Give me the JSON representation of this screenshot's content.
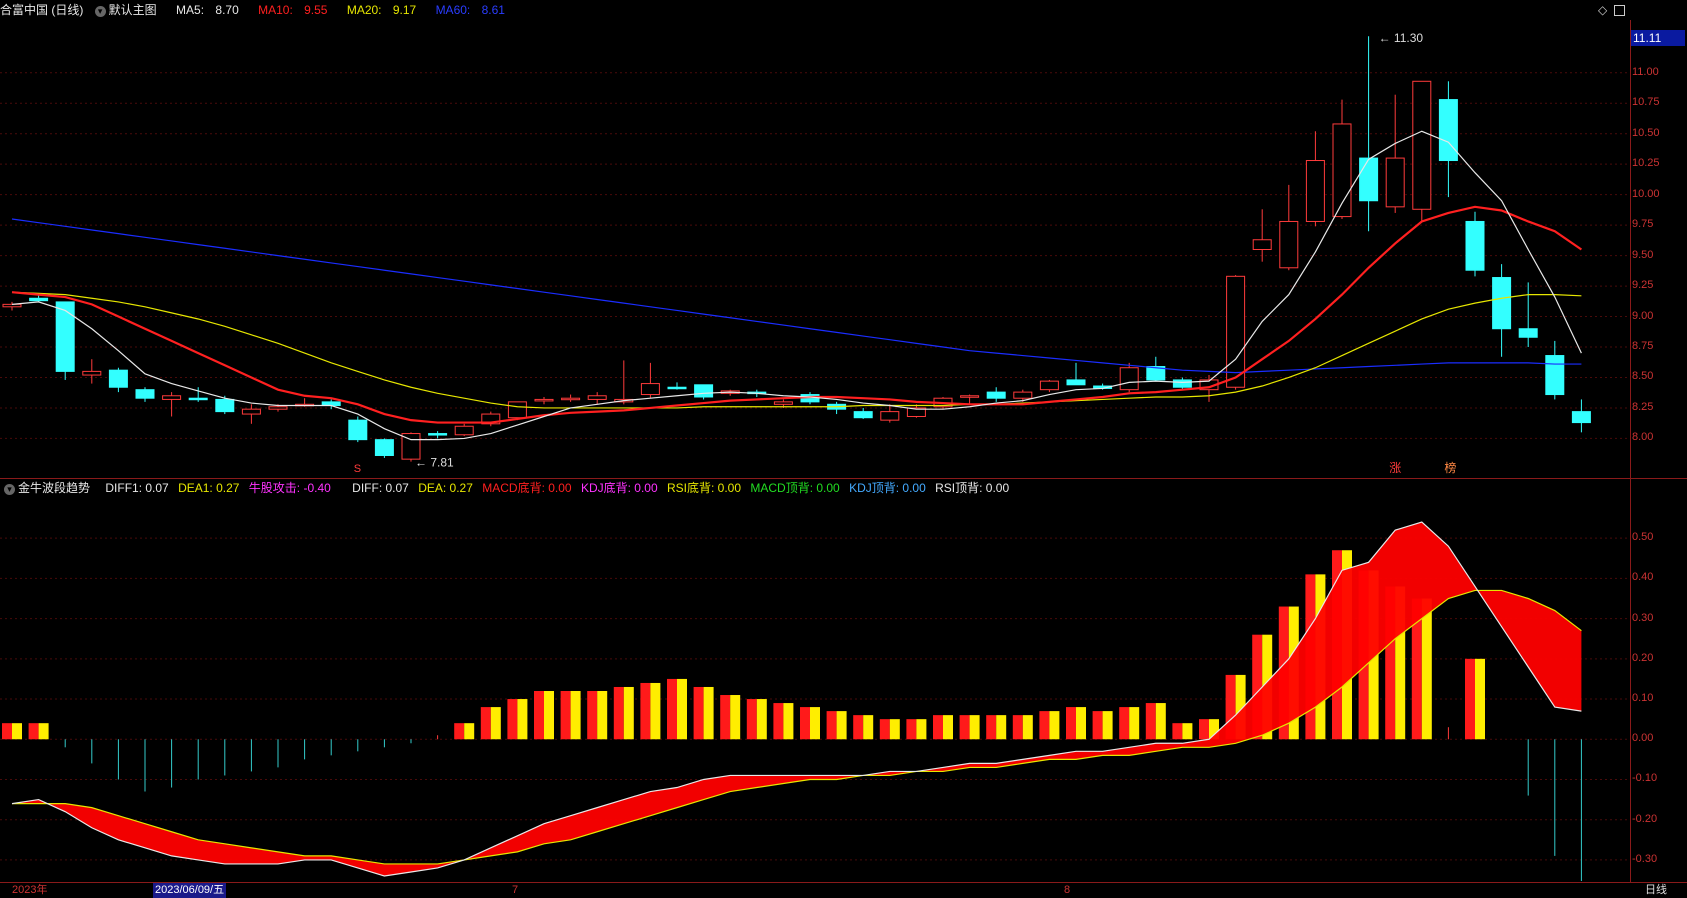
{
  "header": {
    "title": "合富中国 (日线)",
    "template": "默认主图",
    "ma5_label": "MA5:",
    "ma5_value": "8.70",
    "ma10_label": "MA10:",
    "ma10_value": "9.55",
    "ma20_label": "MA20:",
    "ma20_value": "9.17",
    "ma60_label": "MA60:",
    "ma60_value": "8.61"
  },
  "indicator": {
    "name": "金牛波段趋势",
    "diff1": "DIFF1: 0.07",
    "dea1": "DEA1: 0.27",
    "bull": "牛股攻击: -0.40",
    "diff": "DIFF: 0.07",
    "dea": "DEA: 0.27",
    "macd_bottom": "MACD底背: 0.00",
    "kdj_bottom": "KDJ底背: 0.00",
    "rsi_bottom": "RSI底背: 0.00",
    "macd_top": "MACD顶背: 0.00",
    "kdj_top": "KDJ顶背: 0.00",
    "rsi_top": "RSI顶背: 0.00"
  },
  "price_axis": [
    "11.00",
    "10.75",
    "10.50",
    "10.25",
    "10.00",
    "9.75",
    "9.50",
    "9.25",
    "9.00",
    "8.75",
    "8.50",
    "8.25",
    "8.00"
  ],
  "current_price": "11.11",
  "annotations": {
    "high": "11.30",
    "low": "7.81",
    "mark_s": "S",
    "mark_zhang": "涨",
    "mark_bang": "榜"
  },
  "macd_axis": [
    "0.50",
    "0.40",
    "0.30",
    "0.20",
    "0.10",
    "0.00",
    "-0.10",
    "-0.20",
    "-0.30"
  ],
  "dates": {
    "year": "2023年",
    "selected": "2023/06/09/五",
    "m7": "7",
    "m8": "8",
    "period": "日线"
  },
  "colors": {
    "up": "#ff3b3b",
    "down": "#33ffff",
    "ma5": "#e8e8e8",
    "ma10": "#ff2020",
    "ma20": "#e6e600",
    "ma60": "#1a2dff"
  },
  "chart_data": {
    "type": "candlestick",
    "ylim": [
      7.7,
      11.4
    ],
    "candles": [
      {
        "o": 9.08,
        "h": 9.12,
        "l": 9.05,
        "c": 9.1
      },
      {
        "o": 9.15,
        "h": 9.18,
        "l": 9.12,
        "c": 9.13
      },
      {
        "o": 9.12,
        "h": 9.12,
        "l": 8.48,
        "c": 8.55
      },
      {
        "o": 8.52,
        "h": 8.65,
        "l": 8.45,
        "c": 8.55
      },
      {
        "o": 8.56,
        "h": 8.58,
        "l": 8.38,
        "c": 8.42
      },
      {
        "o": 8.4,
        "h": 8.42,
        "l": 8.3,
        "c": 8.33
      },
      {
        "o": 8.32,
        "h": 8.38,
        "l": 8.18,
        "c": 8.35
      },
      {
        "o": 8.33,
        "h": 8.42,
        "l": 8.3,
        "c": 8.32
      },
      {
        "o": 8.32,
        "h": 8.35,
        "l": 8.2,
        "c": 8.22
      },
      {
        "o": 8.2,
        "h": 8.28,
        "l": 8.12,
        "c": 8.24
      },
      {
        "o": 8.24,
        "h": 8.28,
        "l": 8.22,
        "c": 8.26
      },
      {
        "o": 8.28,
        "h": 8.33,
        "l": 8.26,
        "c": 8.28
      },
      {
        "o": 8.3,
        "h": 8.32,
        "l": 8.24,
        "c": 8.27
      },
      {
        "o": 8.15,
        "h": 8.18,
        "l": 7.97,
        "c": 7.99
      },
      {
        "o": 7.99,
        "h": 8.0,
        "l": 7.84,
        "c": 7.86
      },
      {
        "o": 7.83,
        "h": 8.05,
        "l": 7.81,
        "c": 8.04
      },
      {
        "o": 8.04,
        "h": 8.06,
        "l": 8.0,
        "c": 8.03
      },
      {
        "o": 8.03,
        "h": 8.12,
        "l": 8.02,
        "c": 8.1
      },
      {
        "o": 8.12,
        "h": 8.22,
        "l": 8.1,
        "c": 8.2
      },
      {
        "o": 8.17,
        "h": 8.3,
        "l": 8.15,
        "c": 8.3
      },
      {
        "o": 8.32,
        "h": 8.34,
        "l": 8.28,
        "c": 8.32
      },
      {
        "o": 8.33,
        "h": 8.36,
        "l": 8.3,
        "c": 8.33
      },
      {
        "o": 8.32,
        "h": 8.38,
        "l": 8.28,
        "c": 8.35
      },
      {
        "o": 8.3,
        "h": 8.64,
        "l": 8.28,
        "c": 8.32
      },
      {
        "o": 8.36,
        "h": 8.62,
        "l": 8.33,
        "c": 8.45
      },
      {
        "o": 8.42,
        "h": 8.46,
        "l": 8.4,
        "c": 8.41
      },
      {
        "o": 8.44,
        "h": 8.44,
        "l": 8.32,
        "c": 8.34
      },
      {
        "o": 8.37,
        "h": 8.4,
        "l": 8.35,
        "c": 8.39
      },
      {
        "o": 8.38,
        "h": 8.4,
        "l": 8.34,
        "c": 8.37
      },
      {
        "o": 8.28,
        "h": 8.32,
        "l": 8.25,
        "c": 8.3
      },
      {
        "o": 8.36,
        "h": 8.38,
        "l": 8.28,
        "c": 8.3
      },
      {
        "o": 8.28,
        "h": 8.3,
        "l": 8.2,
        "c": 8.24
      },
      {
        "o": 8.22,
        "h": 8.25,
        "l": 8.16,
        "c": 8.17
      },
      {
        "o": 8.15,
        "h": 8.28,
        "l": 8.13,
        "c": 8.22
      },
      {
        "o": 8.18,
        "h": 8.28,
        "l": 8.17,
        "c": 8.25
      },
      {
        "o": 8.26,
        "h": 8.34,
        "l": 8.24,
        "c": 8.33
      },
      {
        "o": 8.34,
        "h": 8.36,
        "l": 8.28,
        "c": 8.35
      },
      {
        "o": 8.38,
        "h": 8.42,
        "l": 8.3,
        "c": 8.33
      },
      {
        "o": 8.33,
        "h": 8.4,
        "l": 8.3,
        "c": 8.38
      },
      {
        "o": 8.4,
        "h": 8.48,
        "l": 8.38,
        "c": 8.47
      },
      {
        "o": 8.48,
        "h": 8.62,
        "l": 8.44,
        "c": 8.44
      },
      {
        "o": 8.43,
        "h": 8.45,
        "l": 8.4,
        "c": 8.41
      },
      {
        "o": 8.4,
        "h": 8.62,
        "l": 8.38,
        "c": 8.58
      },
      {
        "o": 8.59,
        "h": 8.67,
        "l": 8.47,
        "c": 8.48
      },
      {
        "o": 8.48,
        "h": 8.5,
        "l": 8.4,
        "c": 8.42
      },
      {
        "o": 8.4,
        "h": 8.52,
        "l": 8.3,
        "c": 8.48
      },
      {
        "o": 8.42,
        "h": 9.34,
        "l": 8.4,
        "c": 9.33
      },
      {
        "o": 9.55,
        "h": 9.88,
        "l": 9.45,
        "c": 9.63
      },
      {
        "o": 9.4,
        "h": 10.08,
        "l": 9.38,
        "c": 9.78
      },
      {
        "o": 9.78,
        "h": 10.52,
        "l": 9.74,
        "c": 10.28
      },
      {
        "o": 9.82,
        "h": 10.78,
        "l": 9.8,
        "c": 10.58
      },
      {
        "o": 10.3,
        "h": 11.3,
        "l": 9.7,
        "c": 9.95
      },
      {
        "o": 9.9,
        "h": 10.82,
        "l": 9.85,
        "c": 10.3
      },
      {
        "o": 9.88,
        "h": 10.93,
        "l": 9.78,
        "c": 10.93
      },
      {
        "o": 10.78,
        "h": 10.93,
        "l": 9.98,
        "c": 10.28
      },
      {
        "o": 9.78,
        "h": 9.86,
        "l": 9.33,
        "c": 9.38
      },
      {
        "o": 9.32,
        "h": 9.43,
        "l": 8.67,
        "c": 8.9
      },
      {
        "o": 8.9,
        "h": 9.28,
        "l": 8.75,
        "c": 8.83
      },
      {
        "o": 8.68,
        "h": 8.8,
        "l": 8.32,
        "c": 8.36
      },
      {
        "o": 8.22,
        "h": 8.32,
        "l": 8.05,
        "c": 8.13
      }
    ],
    "ma5": [
      9.1,
      9.12,
      9.05,
      8.9,
      8.72,
      8.53,
      8.45,
      8.39,
      8.33,
      8.29,
      8.27,
      8.27,
      8.27,
      8.2,
      8.08,
      7.99,
      7.99,
      8.0,
      8.04,
      8.11,
      8.18,
      8.25,
      8.28,
      8.31,
      8.33,
      8.35,
      8.37,
      8.38,
      8.37,
      8.35,
      8.34,
      8.32,
      8.29,
      8.27,
      8.24,
      8.24,
      8.26,
      8.29,
      8.31,
      8.36,
      8.4,
      8.41,
      8.46,
      8.47,
      8.46,
      8.47,
      8.65,
      8.96,
      9.18,
      9.53,
      9.93,
      10.29,
      10.42,
      10.52,
      10.43,
      10.18,
      9.95,
      9.55,
      9.16,
      8.7
    ],
    "ma10": [
      9.2,
      9.18,
      9.16,
      9.1,
      9.0,
      8.9,
      8.8,
      8.7,
      8.6,
      8.5,
      8.4,
      8.35,
      8.33,
      8.28,
      8.2,
      8.15,
      8.13,
      8.13,
      8.13,
      8.16,
      8.19,
      8.21,
      8.22,
      8.23,
      8.25,
      8.27,
      8.29,
      8.31,
      8.32,
      8.33,
      8.34,
      8.34,
      8.33,
      8.32,
      8.3,
      8.29,
      8.28,
      8.28,
      8.28,
      8.3,
      8.32,
      8.34,
      8.37,
      8.38,
      8.4,
      8.42,
      8.5,
      8.65,
      8.8,
      8.98,
      9.18,
      9.4,
      9.6,
      9.78,
      9.85,
      9.9,
      9.87,
      9.78,
      9.7,
      9.55
    ],
    "ma20": [
      9.2,
      9.19,
      9.18,
      9.15,
      9.12,
      9.08,
      9.03,
      8.98,
      8.92,
      8.85,
      8.78,
      8.7,
      8.62,
      8.55,
      8.48,
      8.42,
      8.37,
      8.33,
      8.29,
      8.26,
      8.25,
      8.25,
      8.25,
      8.25,
      8.25,
      8.25,
      8.26,
      8.26,
      8.26,
      8.26,
      8.26,
      8.26,
      8.27,
      8.27,
      8.27,
      8.27,
      8.28,
      8.28,
      8.29,
      8.3,
      8.31,
      8.32,
      8.33,
      8.34,
      8.34,
      8.35,
      8.38,
      8.43,
      8.5,
      8.58,
      8.68,
      8.78,
      8.88,
      8.98,
      9.06,
      9.11,
      9.15,
      9.18,
      9.18,
      9.17
    ],
    "ma60": [
      9.8,
      9.77,
      9.74,
      9.71,
      9.68,
      9.65,
      9.62,
      9.59,
      9.56,
      9.53,
      9.5,
      9.47,
      9.44,
      9.41,
      9.38,
      9.35,
      9.32,
      9.29,
      9.26,
      9.23,
      9.2,
      9.17,
      9.14,
      9.11,
      9.08,
      9.05,
      9.02,
      8.99,
      8.96,
      8.93,
      8.9,
      8.87,
      8.84,
      8.81,
      8.78,
      8.75,
      8.72,
      8.7,
      8.68,
      8.66,
      8.64,
      8.62,
      8.6,
      8.58,
      8.56,
      8.55,
      8.54,
      8.55,
      8.56,
      8.57,
      8.58,
      8.59,
      8.6,
      8.61,
      8.62,
      8.62,
      8.62,
      8.62,
      8.61,
      8.61
    ],
    "macd": {
      "ylim": [
        -0.34,
        0.58
      ],
      "hist": [
        0.04,
        0.04,
        -0.02,
        -0.06,
        -0.1,
        -0.13,
        -0.12,
        -0.1,
        -0.09,
        -0.08,
        -0.07,
        -0.05,
        -0.04,
        -0.03,
        -0.02,
        -0.01,
        0.01,
        0.04,
        0.08,
        0.1,
        0.12,
        0.12,
        0.12,
        0.13,
        0.14,
        0.15,
        0.13,
        0.11,
        0.1,
        0.09,
        0.08,
        0.07,
        0.06,
        0.05,
        0.05,
        0.06,
        0.06,
        0.06,
        0.06,
        0.07,
        0.08,
        0.07,
        0.08,
        0.09,
        0.04,
        0.05,
        0.16,
        0.26,
        0.33,
        0.41,
        0.47,
        0.42,
        0.38,
        0.35,
        0.03,
        0.2,
        0.0,
        -0.14,
        -0.29,
        -0.4
      ],
      "diff": [
        -0.16,
        -0.15,
        -0.18,
        -0.22,
        -0.25,
        -0.27,
        -0.29,
        -0.3,
        -0.31,
        -0.31,
        -0.31,
        -0.3,
        -0.3,
        -0.32,
        -0.34,
        -0.33,
        -0.32,
        -0.3,
        -0.27,
        -0.24,
        -0.21,
        -0.19,
        -0.17,
        -0.15,
        -0.13,
        -0.12,
        -0.1,
        -0.09,
        -0.09,
        -0.09,
        -0.09,
        -0.09,
        -0.09,
        -0.08,
        -0.08,
        -0.07,
        -0.06,
        -0.06,
        -0.05,
        -0.04,
        -0.03,
        -0.03,
        -0.02,
        -0.01,
        -0.01,
        0.0,
        0.06,
        0.13,
        0.2,
        0.3,
        0.42,
        0.44,
        0.52,
        0.54,
        0.48,
        0.38,
        0.28,
        0.18,
        0.08,
        0.07
      ],
      "dea": [
        -0.16,
        -0.16,
        -0.16,
        -0.17,
        -0.19,
        -0.21,
        -0.23,
        -0.25,
        -0.26,
        -0.27,
        -0.28,
        -0.29,
        -0.29,
        -0.3,
        -0.31,
        -0.31,
        -0.31,
        -0.3,
        -0.29,
        -0.28,
        -0.26,
        -0.25,
        -0.23,
        -0.21,
        -0.19,
        -0.17,
        -0.15,
        -0.13,
        -0.12,
        -0.11,
        -0.1,
        -0.1,
        -0.09,
        -0.09,
        -0.08,
        -0.08,
        -0.07,
        -0.07,
        -0.06,
        -0.05,
        -0.05,
        -0.04,
        -0.04,
        -0.03,
        -0.02,
        -0.02,
        -0.01,
        0.01,
        0.04,
        0.08,
        0.13,
        0.19,
        0.25,
        0.3,
        0.35,
        0.37,
        0.37,
        0.35,
        0.32,
        0.27
      ]
    }
  }
}
